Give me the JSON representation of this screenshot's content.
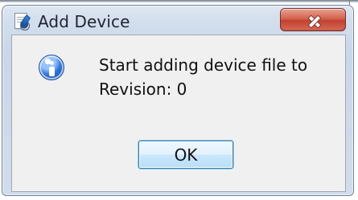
{
  "window": {
    "title": "Add Device",
    "icons": {
      "app": "add-device-app-icon",
      "close": "close-icon",
      "message": "info-icon"
    },
    "colors": {
      "frame": "#d4e0ee",
      "client": "#f0f0f0",
      "close_button": "#c94a39",
      "info_icon": "#2c73d9"
    }
  },
  "message": {
    "line1": "Start adding device file to",
    "line2": "Revision: 0"
  },
  "buttons": {
    "ok": "OK"
  }
}
